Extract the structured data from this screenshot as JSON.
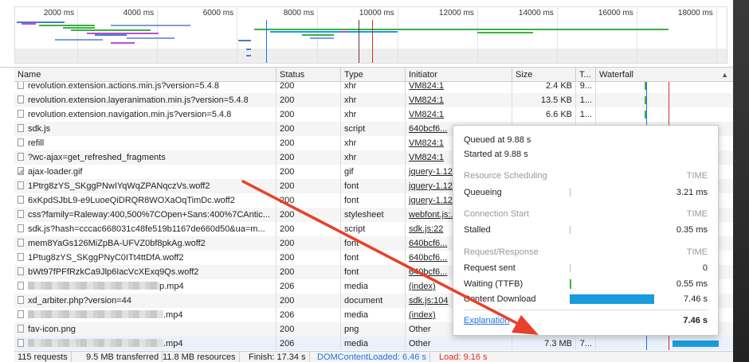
{
  "overview": {
    "ticks": [
      "2000 ms",
      "4000 ms",
      "6000 ms",
      "8000 ms",
      "10000 ms",
      "12000 ms",
      "14000 ms",
      "16000 ms",
      "18000 ms"
    ]
  },
  "columns": {
    "name": "Name",
    "status": "Status",
    "type": "Type",
    "initiator": "Initiator",
    "size": "Size",
    "time": "T...",
    "waterfall": "Waterfall",
    "sort_arrow": "▲"
  },
  "rows": [
    {
      "name": "revolution.extension.actions.min.js?version=5.4.8",
      "status": "200",
      "type": "xhr",
      "initiator": "VM824:1",
      "size": "2.4 KB",
      "time": "9...",
      "icon": "file-icon"
    },
    {
      "name": "revolution.extension.layeranimation.min.js?version=5.4.8",
      "status": "200",
      "type": "xhr",
      "initiator": "VM824:1",
      "size": "13.5 KB",
      "time": "1...",
      "icon": "file-icon"
    },
    {
      "name": "revolution.extension.navigation.min.js?version=5.4.8",
      "status": "200",
      "type": "xhr",
      "initiator": "VM824:1",
      "size": "6.6 KB",
      "time": "1...",
      "icon": "file-icon"
    },
    {
      "name": "sdk.js",
      "status": "200",
      "type": "script",
      "initiator": "640bcf6...",
      "size": "",
      "time": "",
      "icon": "file-icon"
    },
    {
      "name": "refill",
      "status": "200",
      "type": "xhr",
      "initiator": "VM824:1",
      "size": "",
      "time": "",
      "icon": "file-icon"
    },
    {
      "name": "?wc-ajax=get_refreshed_fragments",
      "status": "200",
      "type": "xhr",
      "initiator": "VM824:1",
      "size": "",
      "time": "",
      "icon": "file-icon"
    },
    {
      "name": "ajax-loader.gif",
      "status": "200",
      "type": "gif",
      "initiator": "jquery-1.12...",
      "size": "",
      "time": "",
      "icon": "image-icon"
    },
    {
      "name": "1Ptrg8zYS_SKggPNwIYqWqZPANqczVs.woff2",
      "status": "200",
      "type": "font",
      "initiator": "jquery-1.12...",
      "size": "",
      "time": "",
      "icon": "file-icon"
    },
    {
      "name": "6xKpdSJbL9-e9LuoeQiDRQR8WOXaOqTimDc.woff2",
      "status": "200",
      "type": "font",
      "initiator": "jquery-1.12...",
      "size": "",
      "time": "",
      "icon": "file-icon"
    },
    {
      "name": "css?family=Raleway:400,500%7COpen+Sans:400%7CAntic...",
      "status": "200",
      "type": "stylesheet",
      "initiator": "webfont.js:...",
      "size": "",
      "time": "",
      "icon": "file-icon"
    },
    {
      "name": "sdk.js?hash=cccac668031c48fe519b1167de660d50&ua=m...",
      "status": "200",
      "type": "script",
      "initiator": "sdk.js:22",
      "size": "",
      "time": "",
      "icon": "file-icon"
    },
    {
      "name": "mem8YaGs126MiZpBA-UFVZ0bf8pkAg.woff2",
      "status": "200",
      "type": "font",
      "initiator": "640bcf6...",
      "size": "",
      "time": "",
      "icon": "file-icon"
    },
    {
      "name": "1Ptug8zYS_SKggPNyC0ITt4ttDfA.woff2",
      "status": "200",
      "type": "font",
      "initiator": "640bcf6...",
      "size": "",
      "time": "",
      "icon": "file-icon"
    },
    {
      "name": "bWt97fPFfRzkCa9Jlp6IacVcXExq9Qs.woff2",
      "status": "200",
      "type": "font",
      "initiator": "640bcf6...",
      "size": "",
      "time": "",
      "icon": "file-icon"
    },
    {
      "name": "p.mp4",
      "status": "206",
      "type": "media",
      "initiator": "(index)",
      "size": "",
      "time": "",
      "icon": "file-icon",
      "blurred": true
    },
    {
      "name": "xd_arbiter.php?version=44",
      "status": "200",
      "type": "document",
      "initiator": "sdk.js:104",
      "size": "",
      "time": "",
      "icon": "file-icon"
    },
    {
      "name": ".mp4",
      "status": "206",
      "type": "media",
      "initiator": "(index)",
      "size": "",
      "time": "",
      "icon": "file-icon",
      "blurred": true
    },
    {
      "name": "fav-icon.png",
      "status": "200",
      "type": "png",
      "initiator": "Other",
      "size": "",
      "time": "",
      "icon": "file-icon"
    },
    {
      "name": ".mp4",
      "status": "206",
      "type": "media",
      "initiator": "Other",
      "size": "7.3 MB",
      "time": "7...",
      "icon": "file-icon",
      "blurred": true
    }
  ],
  "tooltip": {
    "queued": "Queued at 9.88 s",
    "started": "Started at 9.88 s",
    "sections": [
      {
        "title": "Resource Scheduling",
        "time_label": "TIME",
        "rows": [
          {
            "label": "Queueing",
            "value": "3.21 ms"
          }
        ]
      },
      {
        "title": "Connection Start",
        "time_label": "TIME",
        "rows": [
          {
            "label": "Stalled",
            "value": "0.35 ms"
          }
        ]
      },
      {
        "title": "Request/Response",
        "time_label": "TIME",
        "rows": [
          {
            "label": "Request sent",
            "value": "0"
          },
          {
            "label": "Waiting (TTFB)",
            "value": "0.55 ms"
          },
          {
            "label": "Content Download",
            "value": "7.46 s"
          }
        ]
      }
    ],
    "explanation": "Explanation",
    "total": "7.46 s"
  },
  "status": {
    "requests": "115 requests",
    "transferred": "9.5 MB transferred",
    "resources": "11.8 MB resources",
    "finish": "Finish: 17.34 s",
    "dcl": "DOMContentLoaded: 6.46 s",
    "load": "Load: 9.16 s"
  },
  "colors": {
    "accent_blue": "#1a9be0",
    "green": "#3cb043",
    "dcl_blue": "#1a73e8",
    "load_red": "#d93025",
    "annotation_red": "#e8402a"
  }
}
